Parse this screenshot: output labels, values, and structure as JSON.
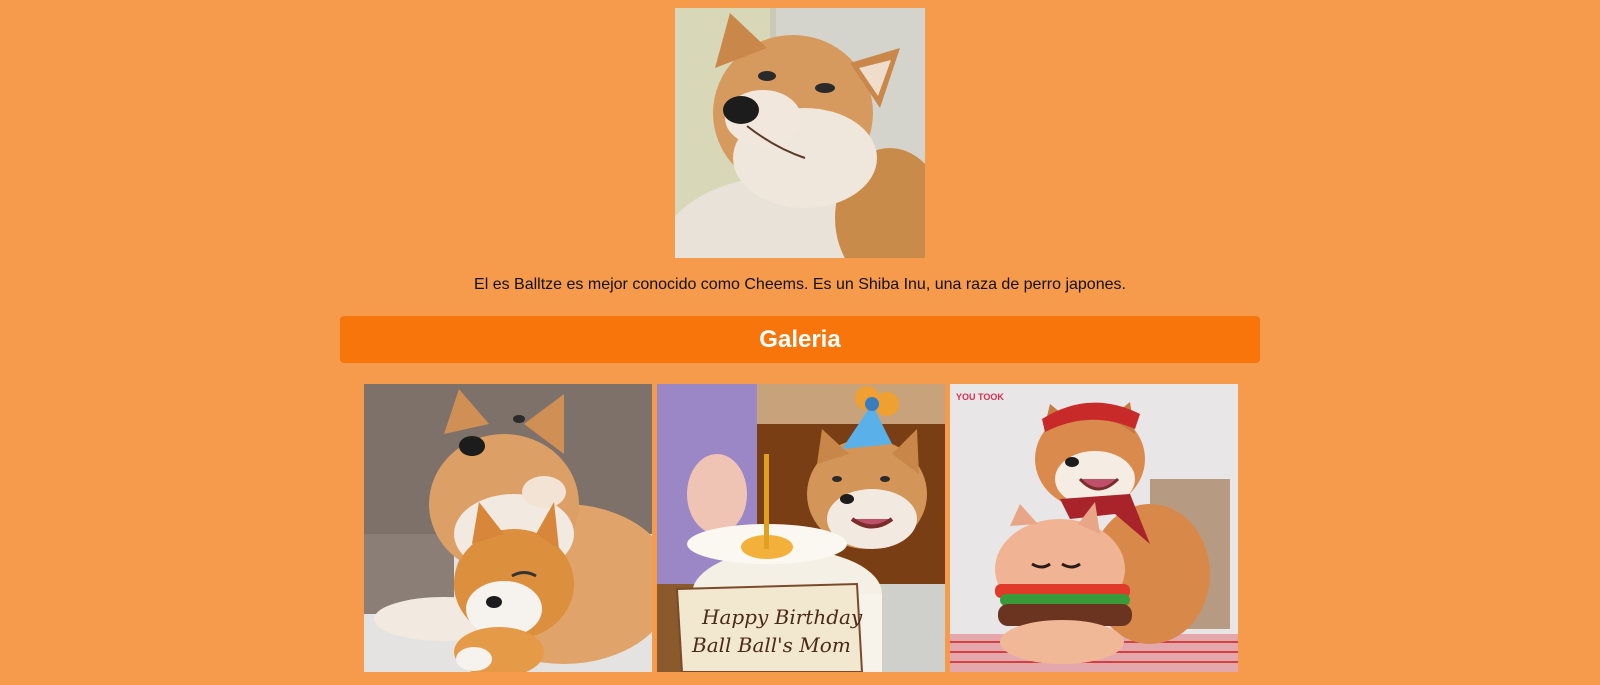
{
  "page": {
    "background_color": "#f69a4c"
  },
  "hero": {
    "image_name": "cheems-portrait-photo"
  },
  "intro": {
    "text": "El es Balltze es mejor conocido como Cheems. Es un Shiba Inu, una raza de perro japones."
  },
  "gallery": {
    "title": "Galeria",
    "banner_color": "#f8750b",
    "photos": [
      {
        "name": "shiba-with-plush-photo"
      },
      {
        "name": "shiba-birthday-cake-photo",
        "cake_text": [
          "Happy Birthday",
          "Ball Ball's Mom"
        ]
      },
      {
        "name": "shiba-with-burger-plush-photo",
        "corner_logo": "YOU TOOK"
      }
    ]
  }
}
